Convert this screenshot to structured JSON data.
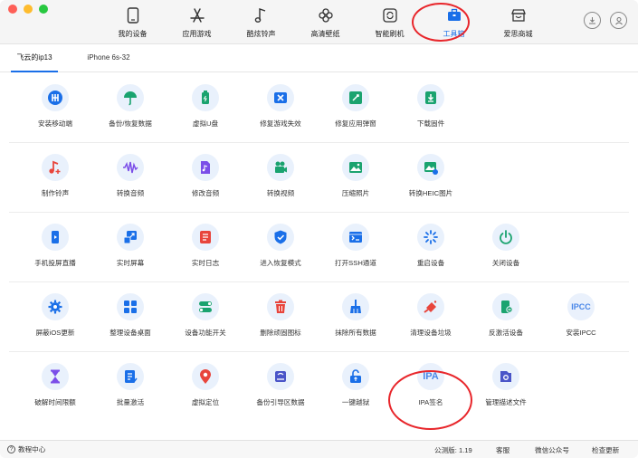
{
  "toolbar": {
    "nav": [
      {
        "label": "我的设备",
        "icon": "phone-icon"
      },
      {
        "label": "应用游戏",
        "icon": "app-store-icon"
      },
      {
        "label": "酷炫铃声",
        "icon": "music-note-icon"
      },
      {
        "label": "高清壁纸",
        "icon": "flower-icon"
      },
      {
        "label": "智能刷机",
        "icon": "refresh-icon"
      },
      {
        "label": "工具箱",
        "icon": "toolbox-icon",
        "active": true
      },
      {
        "label": "爱思商城",
        "icon": "store-icon"
      }
    ]
  },
  "tabs": [
    "飞云的ip13",
    "iPhone 6s-32"
  ],
  "tools": {
    "row1": [
      "安装移动端",
      "备份/恢复数据",
      "虚拟U盘",
      "修复游戏失效",
      "修复应用弹窗",
      "下载固件"
    ],
    "row2": [
      "制作铃声",
      "转换音频",
      "修改音频",
      "转换视频",
      "压缩照片",
      "转换HEIC图片"
    ],
    "row3": [
      "手机投屏直播",
      "实时屏幕",
      "实时日志",
      "进入恢复模式",
      "打开SSH通道",
      "重启设备",
      "关闭设备"
    ],
    "row4": [
      "屏蔽iOS更新",
      "整理设备桌面",
      "设备功能开关",
      "删除顽固图标",
      "抹除所有数据",
      "清理设备垃圾",
      "反激活设备",
      "安装IPCC"
    ],
    "row5": [
      "破解时间限额",
      "批量激活",
      "虚拟定位",
      "备份引导区数据",
      "一键越狱",
      "IPA签名",
      "管理描述文件"
    ]
  },
  "icon_text": {
    "ipa": "IPA",
    "ipcc": "IPCC"
  },
  "status": {
    "help": "教程中心",
    "version": "公测版: 1.19",
    "service": "客服",
    "wechat": "微信公众号",
    "update": "检查更新"
  },
  "colors": {
    "accent": "#1a6fe8",
    "highlight": "#e8262b",
    "icon_bg": "#e9f1fc"
  }
}
